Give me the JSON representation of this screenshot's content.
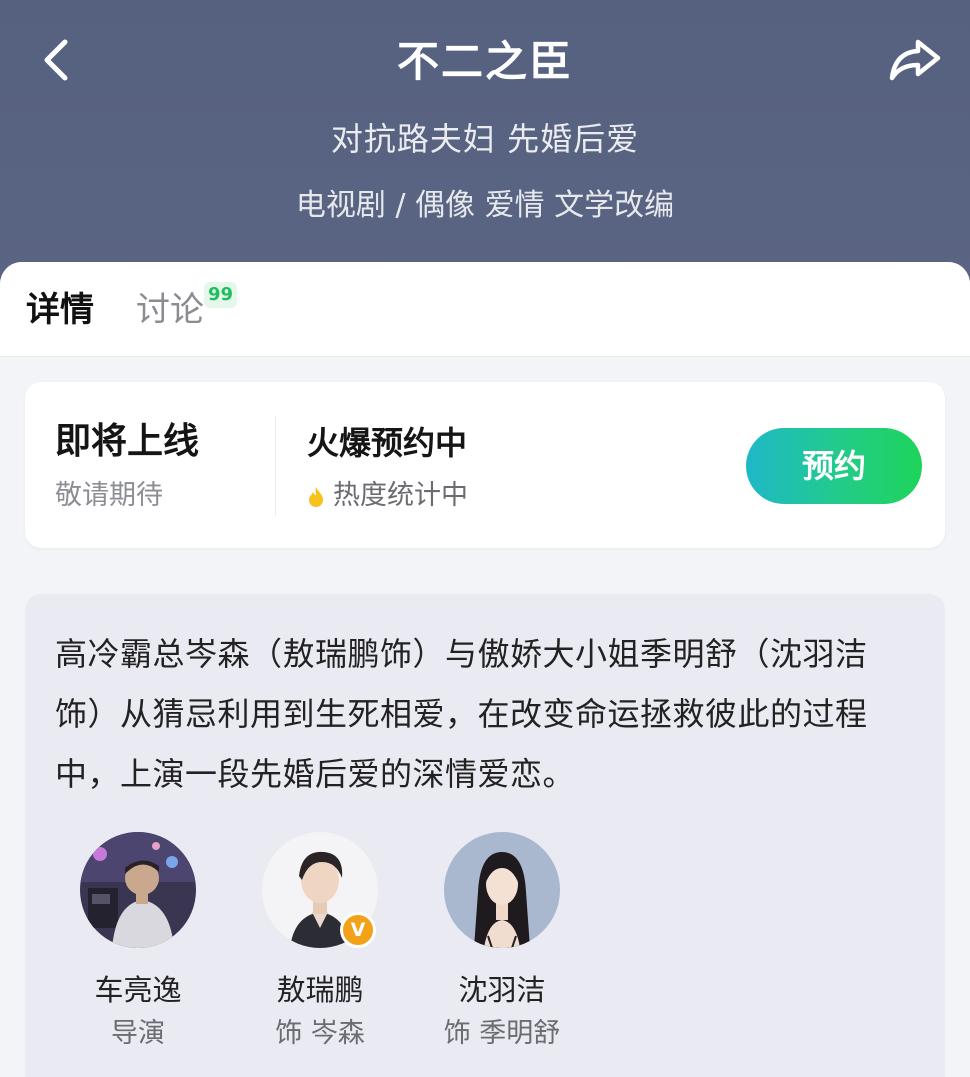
{
  "header": {
    "title": "不二之臣",
    "tagline": "对抗路夫妇 先婚后爱",
    "genre": "电视剧 / 偶像 爱情 文学改编"
  },
  "tabs": [
    {
      "label": "详情",
      "active": true
    },
    {
      "label": "讨论",
      "badge": "99",
      "active": false
    }
  ],
  "status": {
    "main": "即将上线",
    "sub": "敬请期待",
    "hot_main": "火爆预约中",
    "hot_sub": "热度统计中",
    "button_label": "预约"
  },
  "description": {
    "text": "高冷霸总岑森（敖瑞鹏饰）与傲娇大小姐季明舒（沈羽洁饰）从猜忌利用到生死相爱，在改变命运拯救彼此的过程中，上演一段先婚后爱的深情爱恋。"
  },
  "cast": [
    {
      "name": "车亮逸",
      "role": "导演",
      "verified": false
    },
    {
      "name": "敖瑞鹏",
      "role": "饰 岑森",
      "verified": true,
      "badge": "V"
    },
    {
      "name": "沈羽洁",
      "role": "饰 季明舒",
      "verified": false
    }
  ],
  "colors": {
    "header_bg": "#5a6584",
    "accent_green": "#1ed45a",
    "accent_teal": "#1fb8c8",
    "badge_orange": "#f4a11a",
    "flame_yellow": "#f7c21c"
  },
  "icons": {
    "back": "chevron-left-icon",
    "share": "share-arrow-icon",
    "hot": "flame-icon"
  }
}
